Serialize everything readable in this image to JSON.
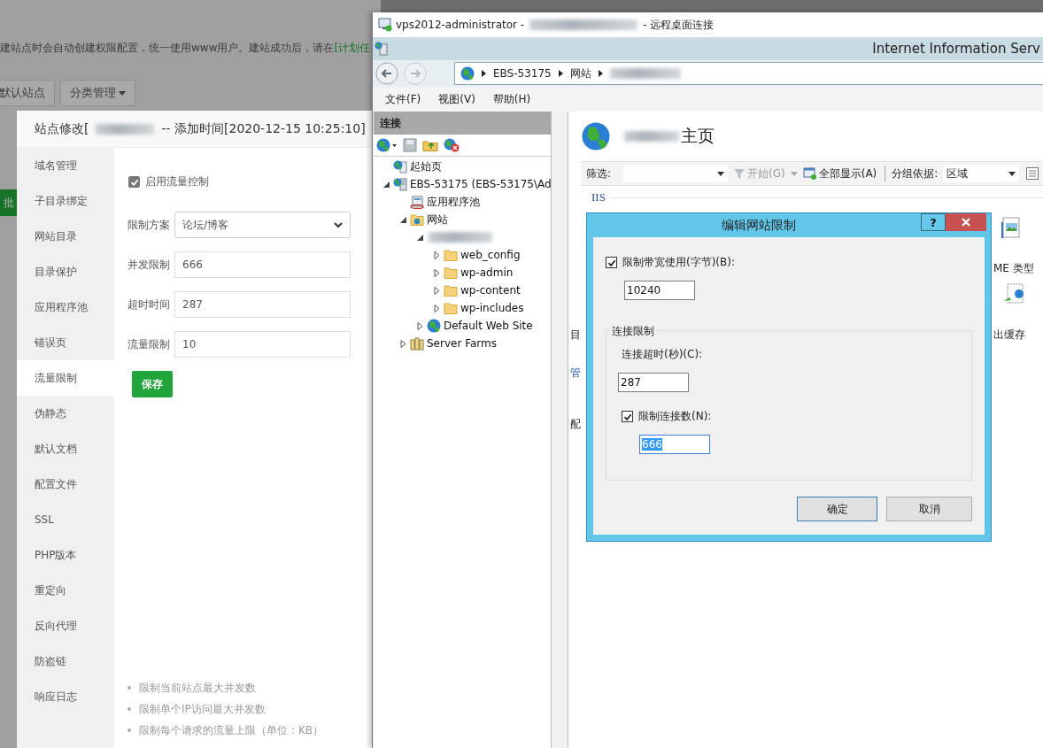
{
  "background_page": {
    "notice": "建站点时会自动创建权限配置，统一使用www用户。建站成功后，请在",
    "notice_link": "[计划任",
    "buttons": [
      {
        "label": "默认站点",
        "dropdown": false
      },
      {
        "label": "分类管理",
        "dropdown": true
      }
    ],
    "side_button": "批"
  },
  "site_modal": {
    "title_start": "站点修改[",
    "title_end": "-- 添加时间[2020-12-15 10:25:10]",
    "nav": [
      {
        "label": "域名管理",
        "selected": false
      },
      {
        "label": "子目录绑定",
        "selected": false
      },
      {
        "label": "网站目录",
        "selected": false
      },
      {
        "label": "目录保护",
        "selected": false
      },
      {
        "label": "应用程序池",
        "selected": false
      },
      {
        "label": "错误页",
        "selected": false
      },
      {
        "label": "流量限制",
        "selected": true
      },
      {
        "label": "伪静态",
        "selected": false
      },
      {
        "label": "默认文档",
        "selected": false
      },
      {
        "label": "配置文件",
        "selected": false
      },
      {
        "label": "SSL",
        "selected": false
      },
      {
        "label": "PHP版本",
        "selected": false
      },
      {
        "label": "重定向",
        "selected": false
      },
      {
        "label": "反向代理",
        "selected": false
      },
      {
        "label": "防盗链",
        "selected": false
      },
      {
        "label": "响应日志",
        "selected": false
      }
    ],
    "traffic_control": {
      "label": "启用流量控制",
      "checked": true
    },
    "fields": [
      {
        "kind": "select",
        "label": "限制方案",
        "value": "论坛/博客"
      },
      {
        "kind": "input",
        "label": "并发限制",
        "value": "666"
      },
      {
        "kind": "input",
        "label": "超时时间",
        "value": "287"
      },
      {
        "kind": "input",
        "label": "流量限制",
        "value": "10"
      }
    ],
    "save_button": "保存",
    "hints": [
      "限制当前站点最大并发数",
      "限制单个IP访问最大并发数",
      "限制每个请求的流量上限（单位：KB）"
    ]
  },
  "remote_desktop": {
    "title_start": "vps2012-administrator -",
    "title_end": "- 远程桌面连接",
    "iis": {
      "title": "Internet Information Serv",
      "breadcrumb": [
        "EBS-53175",
        "网站"
      ],
      "menu": [
        "文件(F)",
        "视图(V)",
        "帮助(H)"
      ],
      "connections": {
        "header": "连接",
        "tree": [
          {
            "kind": "start-page",
            "label": "起始页"
          },
          {
            "kind": "server",
            "label": "EBS-53175 (EBS-53175\\Ad",
            "expanded": true,
            "children": [
              {
                "kind": "app-pools",
                "label": "应用程序池"
              },
              {
                "kind": "sites",
                "label": "网站",
                "expanded": true,
                "children": [
                  {
                    "kind": "site",
                    "expanded": true,
                    "children": [
                      {
                        "kind": "folder",
                        "label": "web_config",
                        "expanded": false
                      },
                      {
                        "kind": "folder",
                        "label": "wp-admin",
                        "expanded": false
                      },
                      {
                        "kind": "folder",
                        "label": "wp-content",
                        "expanded": false
                      },
                      {
                        "kind": "folder",
                        "label": "wp-includes",
                        "expanded": false
                      }
                    ]
                  },
                  {
                    "kind": "globe",
                    "label": "Default Web Site",
                    "expanded": false
                  }
                ]
              },
              {
                "kind": "farm",
                "label": "Server Farms",
                "expanded": false
              }
            ]
          }
        ]
      },
      "home": {
        "title": "主页",
        "filter_label": "筛选:",
        "start_button": {
          "label": "开始(G)",
          "disabled": true
        },
        "show_all": "全部显示(A)",
        "group_by_label": "分组依据:",
        "group_by": "区域",
        "section": "IIS",
        "partial_labels": [
          "目",
          "管",
          "配",
          "ME 类型",
          "出缓存"
        ]
      }
    }
  },
  "dialog": {
    "title": "编辑网站限制",
    "help": "?",
    "bandwidth": {
      "label": "限制带宽使用(字节)(B):",
      "checked": true,
      "value": "10240"
    },
    "group_label": "连接限制",
    "timeout": {
      "label": "连接超时(秒)(C):",
      "value": "287"
    },
    "connection_count": {
      "label": "限制连接数(N):",
      "checked": true,
      "value": "666",
      "text_selected": true
    },
    "buttons": [
      {
        "label": "确定",
        "default": true
      },
      {
        "label": "取消",
        "default": false
      }
    ]
  }
}
